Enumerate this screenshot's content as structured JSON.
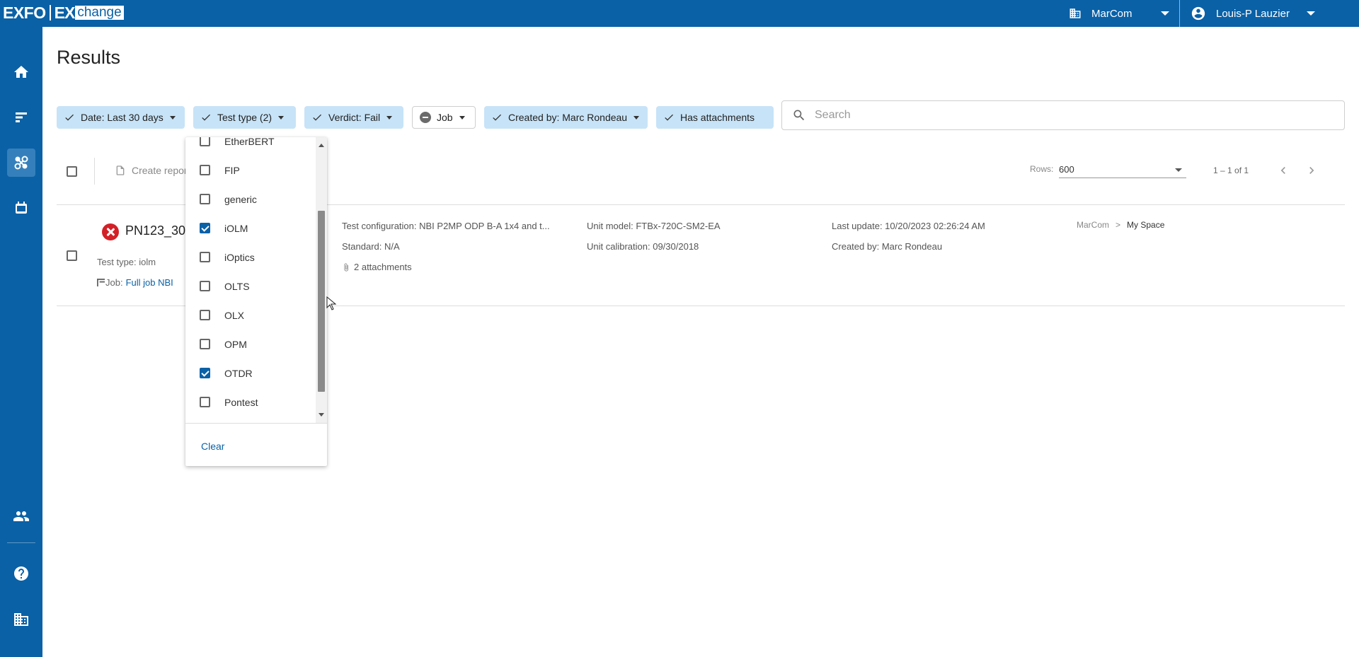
{
  "app": {
    "logo_brand": "EXFO",
    "logo_ex": "EX",
    "logo_change": "change",
    "org": "MarCom",
    "user": "Louis-P Lauzier"
  },
  "page": {
    "title": "Results"
  },
  "filters": {
    "date": "Date: Last 30 days",
    "test_type": "Test type (2)",
    "verdict": "Verdict: Fail",
    "job": "Job",
    "created_by": "Created by: Marc Rondeau",
    "attachments": "Has attachments"
  },
  "search": {
    "placeholder": "Search"
  },
  "toolbar": {
    "create_report": "Create repor"
  },
  "pagination": {
    "rows_label": "Rows:",
    "rows_value": "600",
    "range": "1 – 1 of 1"
  },
  "result": {
    "name": "PN123_30",
    "test_type": "Test type: iolm",
    "job_label": "Job:",
    "job_link": "Full job NBI",
    "test_config": "Test configuration: NBI P2MP ODP B-A 1x4 and t...",
    "standard": "Standard: N/A",
    "attachments": "2 attachments",
    "unit_model": "Unit model: FTBx-720C-SM2-EA",
    "unit_calibration": "Unit calibration: 09/30/2018",
    "last_update": "Last update: 10/20/2023 02:26:24 AM",
    "created_by": "Created by: Marc Rondeau",
    "breadcrumb_root": "MarCom",
    "breadcrumb_current": "My Space"
  },
  "test_type_options": [
    {
      "label": "EtherBERT",
      "checked": false
    },
    {
      "label": "FIP",
      "checked": false
    },
    {
      "label": "generic",
      "checked": false
    },
    {
      "label": "iOLM",
      "checked": true
    },
    {
      "label": "iOptics",
      "checked": false
    },
    {
      "label": "OLTS",
      "checked": false
    },
    {
      "label": "OLX",
      "checked": false
    },
    {
      "label": "OPM",
      "checked": false
    },
    {
      "label": "OTDR",
      "checked": true
    },
    {
      "label": "Pontest",
      "checked": false
    }
  ],
  "dropdown": {
    "clear": "Clear"
  },
  "colors": {
    "brand": "#0a61a6",
    "chip": "#c7e3f7",
    "fail": "#d32027"
  }
}
